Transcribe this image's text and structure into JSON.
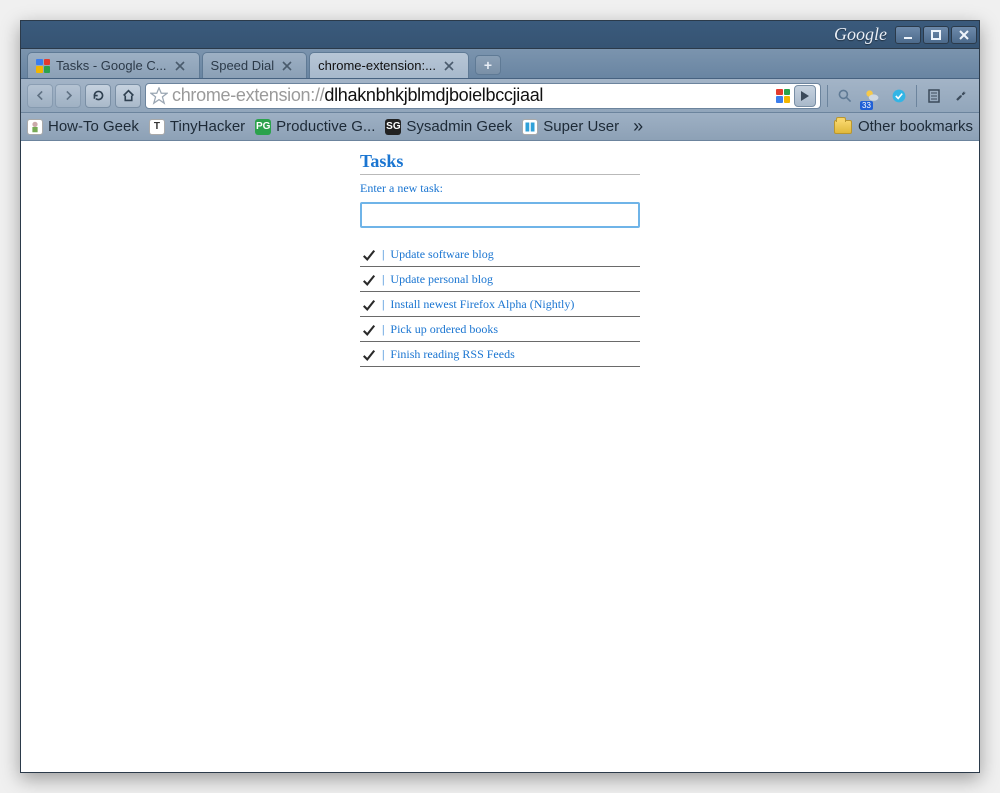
{
  "brand": "Google",
  "tabs": [
    {
      "label": "Tasks - Google C...",
      "active": false
    },
    {
      "label": "Speed Dial",
      "active": false
    },
    {
      "label": "chrome-extension:...",
      "active": true
    }
  ],
  "url": {
    "scheme": "chrome-extension://",
    "path": "dlhaknbhkjblmdjboielbccjiaal"
  },
  "bookmarks": [
    {
      "label": "How-To Geek"
    },
    {
      "label": "TinyHacker"
    },
    {
      "label": "Productive G..."
    },
    {
      "label": "Sysadmin Geek"
    },
    {
      "label": "Super User"
    }
  ],
  "other_bookmarks_label": "Other bookmarks",
  "weather_badge": "33",
  "page": {
    "title": "Tasks",
    "input_label": "Enter a new task:",
    "input_placeholder": "",
    "tasks": [
      "Update software blog",
      "Update personal blog",
      "Install newest Firefox Alpha (Nightly)",
      "Pick up ordered books",
      "Finish reading RSS Feeds"
    ]
  }
}
